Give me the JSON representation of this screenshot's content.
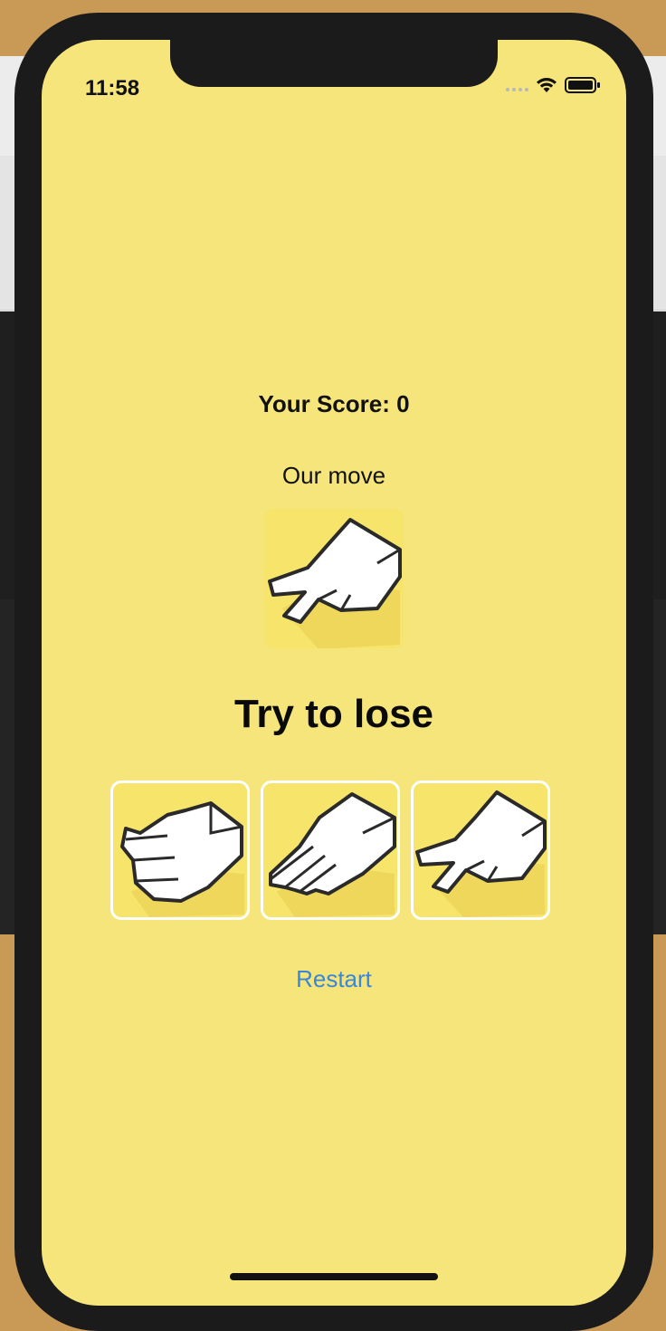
{
  "status_bar": {
    "time": "11:58"
  },
  "game": {
    "score_text": "Your Score: 0",
    "our_move_label": "Our move",
    "our_move": "scissors",
    "prompt": "Try to lose",
    "choices": [
      "rock",
      "paper",
      "scissors"
    ],
    "restart_label": "Restart"
  },
  "colors": {
    "screen_bg": "#f6e57a",
    "accent_link": "#3a86d8"
  }
}
